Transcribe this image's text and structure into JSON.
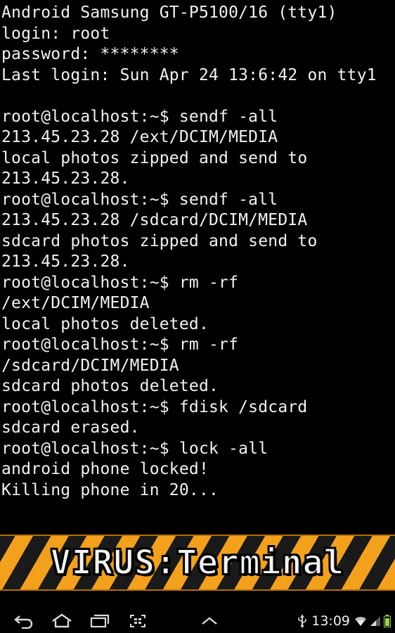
{
  "terminal": {
    "lines": [
      "Android Samsung GT-P5100/16 (tty1)",
      "login: root",
      "password: ********",
      "Last login: Sun Apr 24 13:6:42 on tty1",
      "",
      "root@localhost:~$ sendf -all",
      "213.45.23.28 /ext/DCIM/MEDIA",
      "local photos zipped and send to",
      "213.45.23.28.",
      "root@localhost:~$ sendf -all",
      "213.45.23.28 /sdcard/DCIM/MEDIA",
      "sdcard photos zipped and send to",
      "213.45.23.28.",
      "root@localhost:~$ rm -rf",
      "/ext/DCIM/MEDIA",
      "local photos deleted.",
      "root@localhost:~$ rm -rf",
      "/sdcard/DCIM/MEDIA",
      "sdcard photos deleted.",
      "root@localhost:~$ fdisk /sdcard",
      "sdcard erased.",
      "root@localhost:~$ lock -all",
      "android phone locked!",
      "Killing phone in 20..."
    ]
  },
  "banner": {
    "title": "VIRUS:Terminal",
    "stripe_colors": [
      "#f3a11c",
      "#1a1a1a"
    ]
  },
  "system_bar": {
    "buttons": [
      "back-icon",
      "home-icon",
      "recent-apps-icon",
      "screenshot-icon",
      "menu-up-icon"
    ],
    "clock": "13:09",
    "status_icons": [
      "usb-icon",
      "wifi-icon",
      "signal-icon",
      "battery-icon"
    ]
  },
  "colors": {
    "background": "#000000",
    "terminal_text": "#f2f2f2",
    "nav_icon": "#d8d8d8"
  }
}
